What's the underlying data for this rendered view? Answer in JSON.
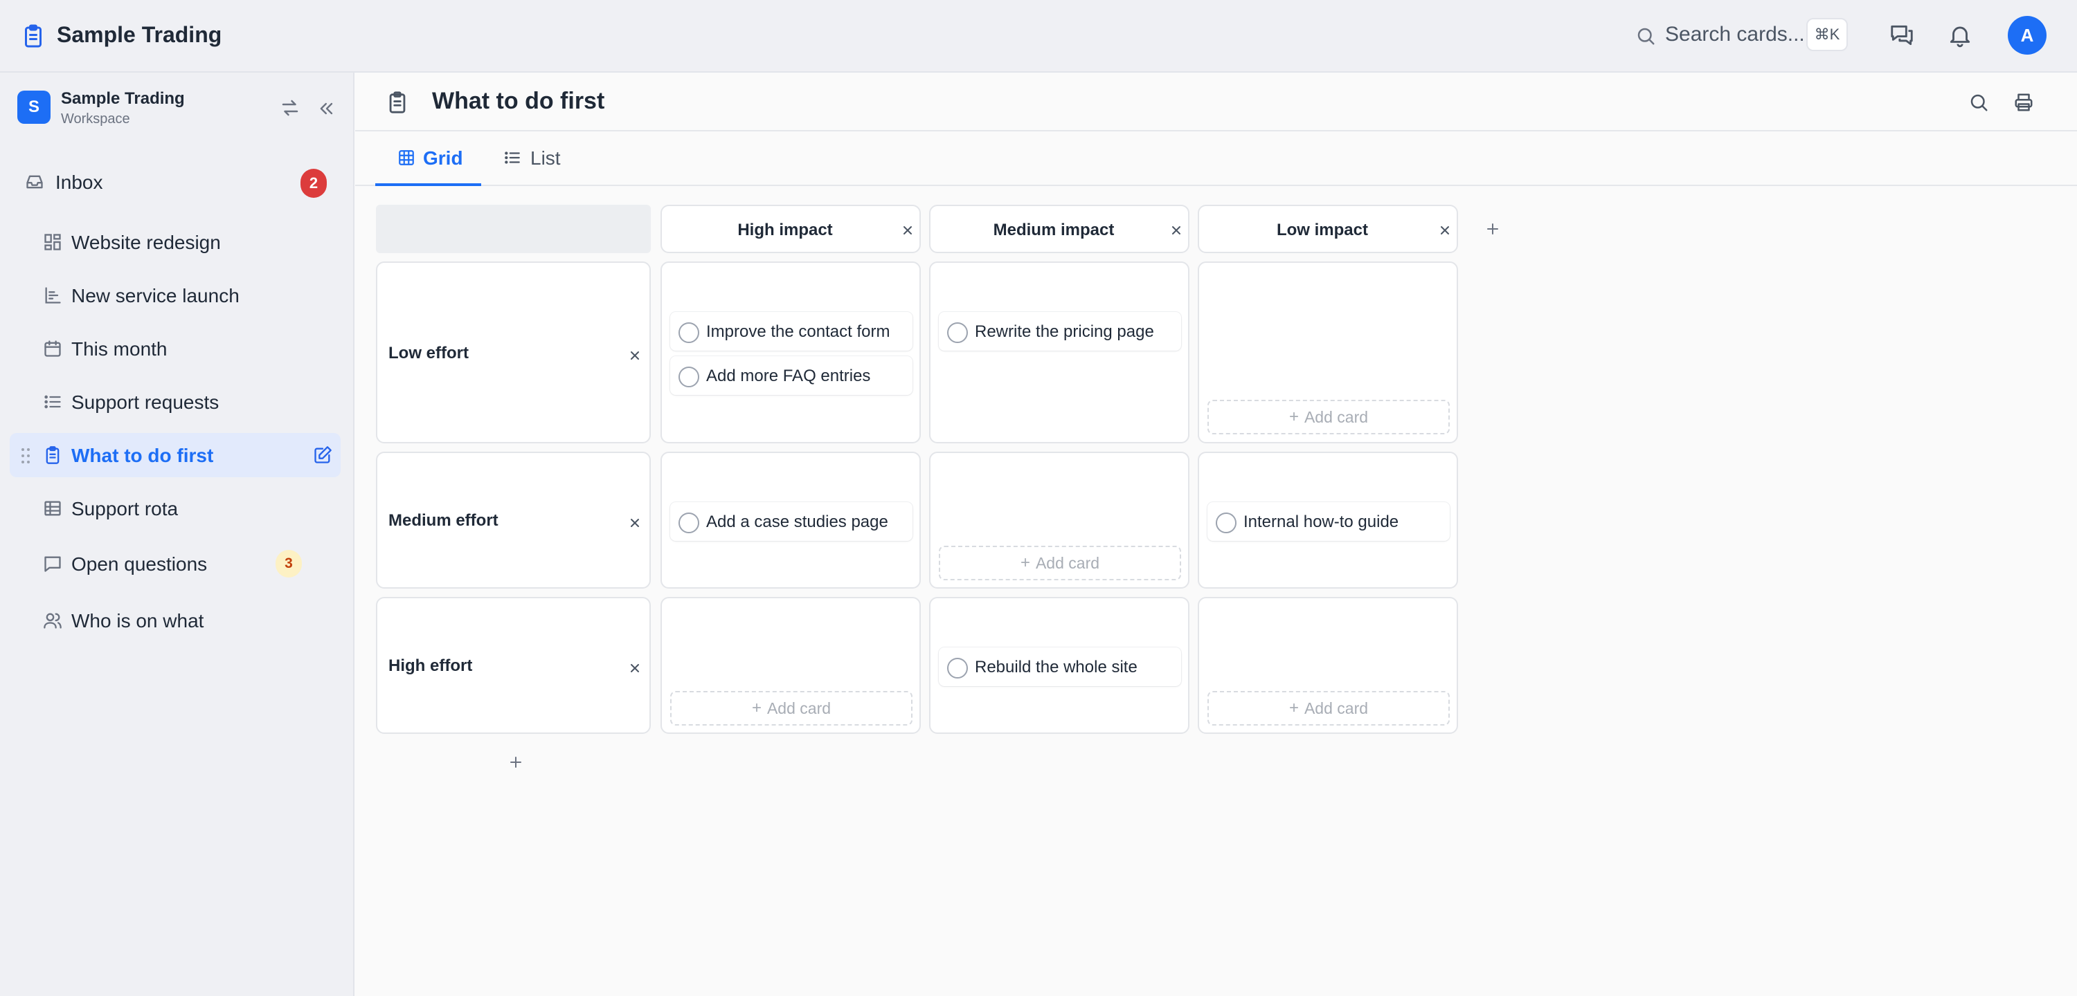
{
  "app": {
    "title": "Sample Trading",
    "search_placeholder": "Search cards...",
    "search_shortcut": "⌘K",
    "user_initial": "A"
  },
  "colors": {
    "accent": "#1d6ef5",
    "badge_red": "#dc3c3c",
    "badge_yellow_bg": "#fdf1c4",
    "active_nav_bg": "#e2eafc"
  },
  "workspace": {
    "initial": "S",
    "name": "Sample Trading",
    "subtitle": "Workspace"
  },
  "sidebar": {
    "items": [
      {
        "label": "Inbox",
        "icon": "inbox-icon",
        "badge": "2"
      },
      {
        "label": "Website redesign",
        "icon": "dashboard-icon"
      },
      {
        "label": "New service launch",
        "icon": "chart-icon"
      },
      {
        "label": "This month",
        "icon": "calendar-icon"
      },
      {
        "label": "Support requests",
        "icon": "list-icon"
      },
      {
        "label": "What to do first",
        "icon": "clipboard-icon",
        "active": true
      },
      {
        "label": "Support rota",
        "icon": "table-icon"
      },
      {
        "label": "Open questions",
        "icon": "chat-icon",
        "badge": "3"
      },
      {
        "label": "Who is on what",
        "icon": "users-icon"
      }
    ]
  },
  "page": {
    "title": "What to do first",
    "tabs": [
      {
        "label": "Grid",
        "icon": "grid-icon",
        "active": true
      },
      {
        "label": "List",
        "icon": "list-icon"
      }
    ]
  },
  "grid": {
    "columns": [
      "High impact",
      "Medium impact",
      "Low impact"
    ],
    "rows": [
      "Low effort",
      "Medium effort",
      "High effort"
    ],
    "add_card_label": "Add card",
    "cards": {
      "low_high": [
        "Improve the contact form",
        "Add more FAQ entries"
      ],
      "low_medium": [
        "Rewrite the pricing page"
      ],
      "medium_high": [
        "Add a case studies page"
      ],
      "medium_low": [
        "Internal how-to guide"
      ],
      "high_medium": [
        "Rebuild the whole site"
      ]
    }
  }
}
